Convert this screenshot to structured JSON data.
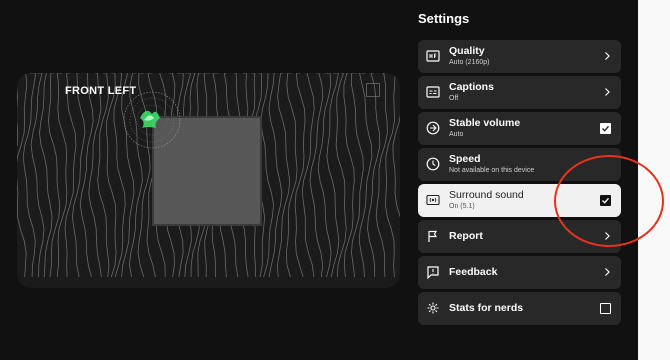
{
  "video": {
    "speaker_label": "FRONT LEFT"
  },
  "settings": {
    "title": "Settings",
    "rows": [
      {
        "label": "Quality",
        "sub": "Auto (2160p)",
        "control": "chevron",
        "icon": "quality-icon"
      },
      {
        "label": "Captions",
        "sub": "Off",
        "control": "chevron",
        "icon": "captions-icon"
      },
      {
        "label": "Stable volume",
        "sub": "Auto",
        "control": "checkbox",
        "checked": true,
        "icon": "stable-volume-icon"
      },
      {
        "label": "Speed",
        "sub": "Not available on this device",
        "control": "chevron",
        "icon": "clock-icon"
      },
      {
        "label": "Surround sound",
        "sub": "On (5.1)",
        "control": "checkbox",
        "checked": true,
        "active": true,
        "icon": "surround-sound-icon"
      },
      {
        "label": "Report",
        "sub": "",
        "control": "chevron",
        "icon": "flag-icon"
      },
      {
        "label": "Feedback",
        "sub": "",
        "control": "chevron",
        "icon": "feedback-icon"
      },
      {
        "label": "Stats for nerds",
        "sub": "",
        "control": "checkbox",
        "checked": false,
        "icon": "gear-icon"
      }
    ]
  },
  "colors": {
    "background": "#111111",
    "row": "#282828",
    "active_row": "#f1f1f1",
    "annotation": "#e8321e",
    "orb_green": "#3ddc6a"
  }
}
